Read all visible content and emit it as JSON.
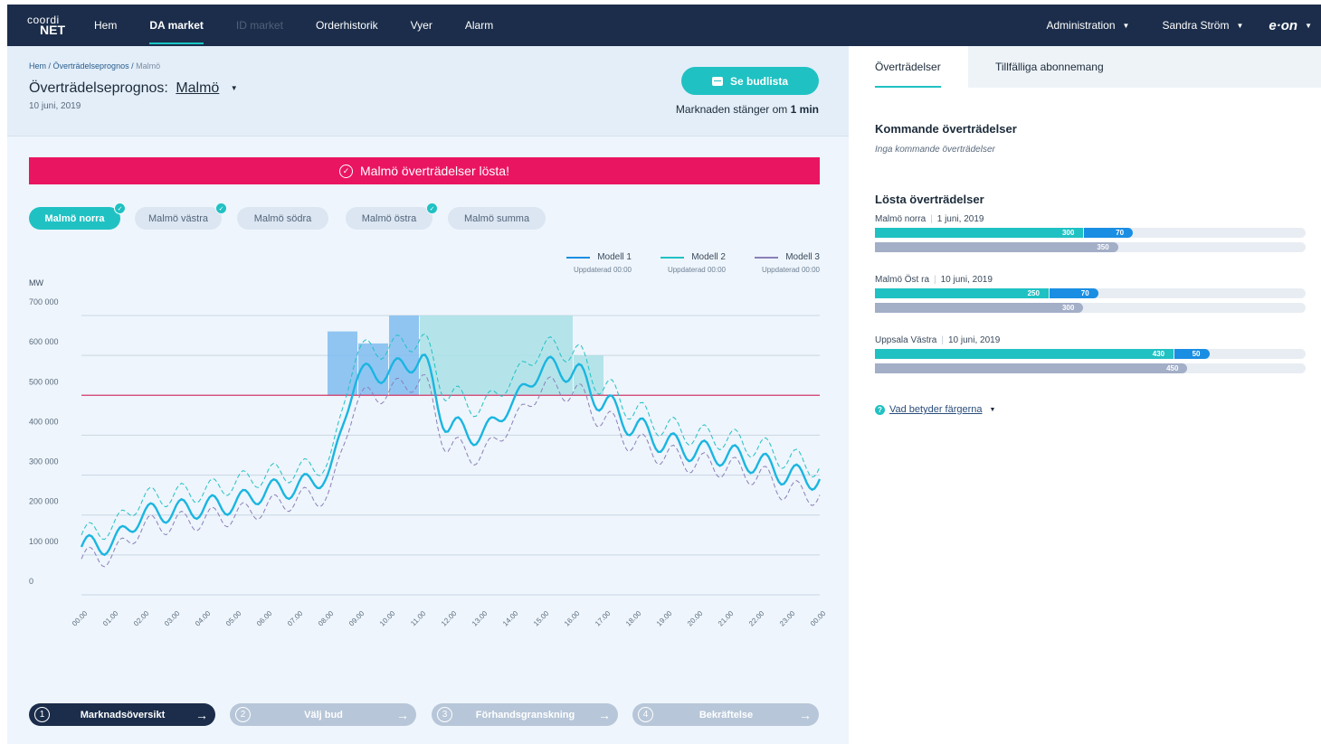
{
  "nav": {
    "logo_top": "coordi",
    "logo_bottom": "NET",
    "items": [
      {
        "label": "Hem"
      },
      {
        "label": "DA market"
      },
      {
        "label": "ID market"
      },
      {
        "label": "Orderhistorik"
      },
      {
        "label": "Vyer"
      },
      {
        "label": "Alarm"
      }
    ],
    "admin_label": "Administration",
    "user_label": "Sandra Ström",
    "brand": "e·on"
  },
  "header": {
    "breadcrumb_home": "Hem",
    "breadcrumb_mid": "Överträdelseprognos",
    "breadcrumb_current": "Malmö",
    "title": "Överträdelseprognos:",
    "title_selection": "Malmö",
    "date": "10 juni, 2019",
    "bid_button": "Se budlista",
    "closing_prefix": "Marknaden stänger om",
    "closing_time": "1 min"
  },
  "alert": {
    "text": "Malmö överträdelser lösta!"
  },
  "chips": [
    {
      "label": "Malmö norra",
      "active": true,
      "resolved": true
    },
    {
      "label": "Malmö västra",
      "active": false,
      "resolved": true
    },
    {
      "label": "Malmö södra",
      "active": false,
      "resolved": false
    },
    {
      "label": "Malmö östra",
      "active": false,
      "resolved": true
    },
    {
      "label": "Malmö summa",
      "active": false,
      "resolved": false
    }
  ],
  "legend": [
    {
      "label": "Modell 1",
      "updated": "Uppdaterad 00:00",
      "color": "#1a8ee3"
    },
    {
      "label": "Modell 2",
      "updated": "Uppdaterad 00:00",
      "color": "#20c1c3"
    },
    {
      "label": "Modell 3",
      "updated": "Uppdaterad 00:00",
      "color": "#8b7fb8"
    }
  ],
  "chart_data": {
    "type": "line",
    "ylabel": "MW",
    "ylim": [
      0,
      700000
    ],
    "y_ticks": [
      "700 000",
      "600 000",
      "500 000",
      "400 000",
      "300 000",
      "200 000",
      "100 000",
      "0"
    ],
    "y_tick_values": [
      700000,
      600000,
      500000,
      400000,
      300000,
      200000,
      100000,
      0
    ],
    "x": [
      "00.00",
      "01.00",
      "02.00",
      "03.00",
      "04.00",
      "05.00",
      "06.00",
      "07.00",
      "08.00",
      "09.00",
      "10.00",
      "11.00",
      "12.00",
      "13.00",
      "14.00",
      "15.00",
      "16.00",
      "17.00",
      "18.00",
      "19.00",
      "20.00",
      "21.00",
      "22.00",
      "23.00",
      "00.00"
    ],
    "limit": 500000,
    "series": [
      {
        "name": "Modell 1",
        "color": "#1ab5e0",
        "values": [
          120000,
          130000,
          200000,
          210000,
          220000,
          230000,
          260000,
          270000,
          300000,
          550000,
          560000,
          590000,
          420000,
          400000,
          480000,
          570000,
          560000,
          480000,
          420000,
          380000,
          360000,
          350000,
          330000,
          300000,
          290000
        ]
      },
      {
        "name": "Modell 2",
        "color": "#20c1c3",
        "values": [
          150000,
          170000,
          240000,
          250000,
          260000,
          280000,
          300000,
          310000,
          330000,
          610000,
          620000,
          640000,
          500000,
          470000,
          540000,
          620000,
          610000,
          520000,
          460000,
          420000,
          400000,
          390000,
          370000,
          340000,
          320000
        ]
      },
      {
        "name": "Modell 3",
        "color": "#8b7fb8",
        "values": [
          90000,
          100000,
          170000,
          180000,
          190000,
          200000,
          220000,
          240000,
          250000,
          490000,
          510000,
          540000,
          370000,
          350000,
          430000,
          520000,
          510000,
          440000,
          380000,
          350000,
          330000,
          320000,
          300000,
          260000,
          250000
        ]
      }
    ],
    "overflow_blocks": [
      {
        "from": 8.0,
        "to": 9.0,
        "top": 660000,
        "color": "#7fbcf0"
      },
      {
        "from": 9.0,
        "to": 10.0,
        "top": 630000,
        "color": "#7fbcf0"
      },
      {
        "from": 10.0,
        "to": 11.0,
        "top": 700000,
        "color": "#7fbcf0"
      },
      {
        "from": 11.0,
        "to": 16.0,
        "top": 700000,
        "color": "#a9e1e6"
      },
      {
        "from": 16.0,
        "to": 17.0,
        "top": 600000,
        "color": "#a9e1e6"
      }
    ]
  },
  "steps": [
    {
      "num": "1",
      "label": "Marknadsöversikt",
      "active": true
    },
    {
      "num": "2",
      "label": "Välj bud",
      "active": false
    },
    {
      "num": "3",
      "label": "Förhandsgranskning",
      "active": false
    },
    {
      "num": "4",
      "label": "Bekräftelse",
      "active": false
    }
  ],
  "right": {
    "tab1": "Överträdelser",
    "tab2": "Tillfälliga abonnemang",
    "upcoming_title": "Kommande överträdelser",
    "upcoming_empty": "Inga kommande överträdelser",
    "resolved_title": "Lösta överträdelser",
    "resolved": [
      {
        "area": "Malmö norra",
        "date": "1 juni, 2019",
        "teal": 300,
        "blue": 70,
        "grey": 350
      },
      {
        "area": "Malmö Öst ra",
        "date": "10 juni, 2019",
        "teal": 250,
        "blue": 70,
        "grey": 300
      },
      {
        "area": "Uppsala Västra",
        "date": "10 juni, 2019",
        "teal": 430,
        "blue": 50,
        "grey": 450
      }
    ],
    "bar_scale_max": 620,
    "help_text": "Vad betyder färgerna"
  }
}
